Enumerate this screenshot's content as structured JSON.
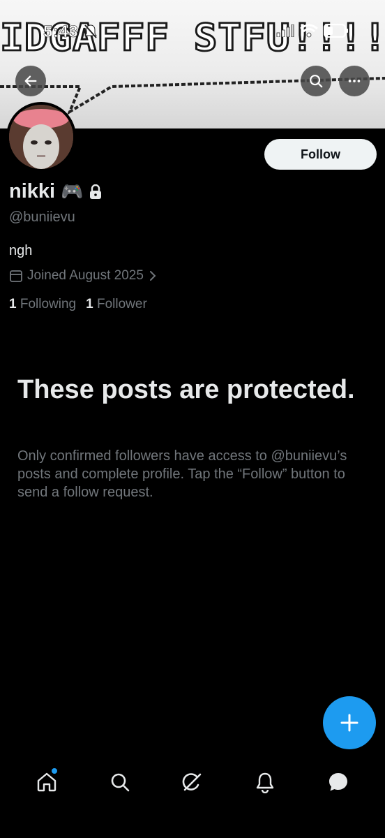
{
  "status_bar": {
    "time": "5:43"
  },
  "banner": {
    "text": "IDGAFFF STFU!!!!"
  },
  "profile": {
    "display_name": "nikki",
    "name_emoji": "🎮",
    "handle": "@buniievu",
    "bio": "ngh",
    "joined": "Joined August 2025",
    "following_count": "1",
    "following_label": "Following",
    "followers_count": "1",
    "followers_label": "Follower"
  },
  "actions": {
    "follow_label": "Follow"
  },
  "protected": {
    "title": "These posts are protected.",
    "body": "Only confirmed followers have access to @buniievu’s posts and complete profile. Tap the “Follow” button to send a follow request."
  },
  "icons": {
    "back": "arrow-left-icon",
    "search": "search-icon",
    "more": "more-icon",
    "lock": "lock-icon",
    "calendar": "calendar-icon",
    "compose": "plus-icon",
    "nav": [
      "home-icon",
      "explore-icon",
      "grok-icon",
      "bell-icon",
      "messages-icon"
    ]
  },
  "colors": {
    "accent": "#1d9bf0",
    "background": "#000000",
    "secondary_text": "#71767b",
    "primary_text": "#e7e9ea"
  }
}
